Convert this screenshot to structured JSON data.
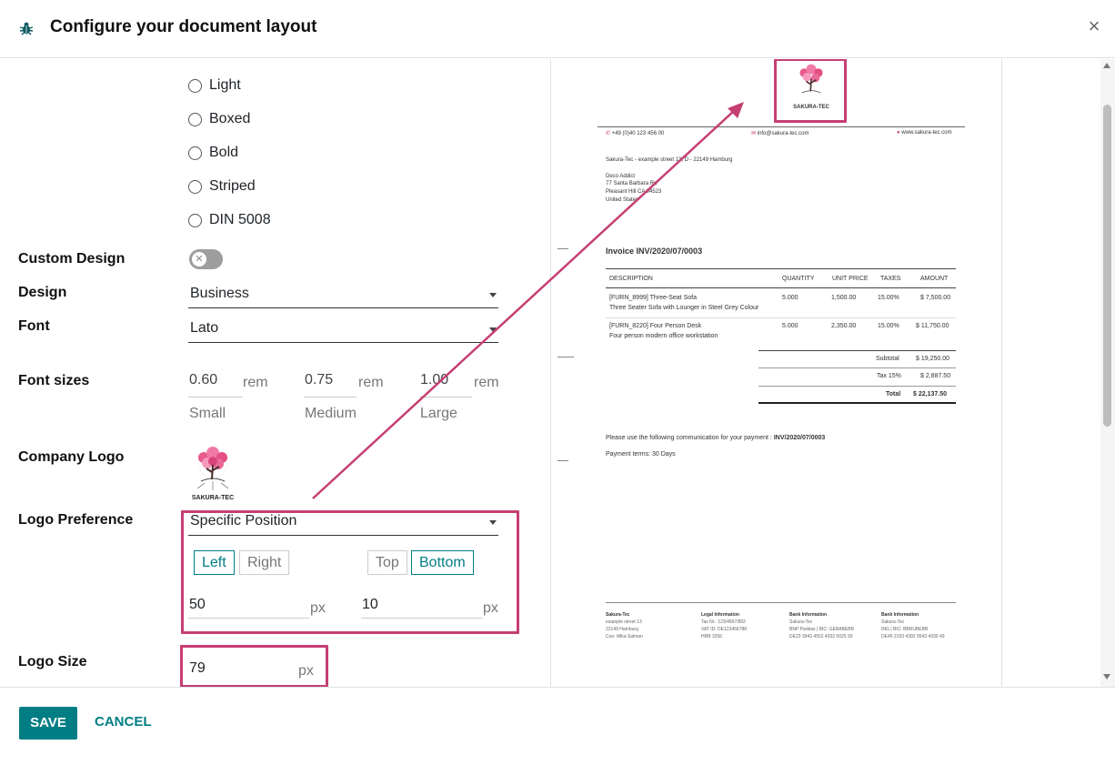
{
  "header": {
    "title": "Configure your document layout",
    "close_label": "×"
  },
  "layouts": [
    "Light",
    "Boxed",
    "Bold",
    "Striped",
    "DIN 5008"
  ],
  "fields": {
    "custom_design": "Custom Design",
    "design": "Design",
    "font": "Font",
    "font_sizes": "Font sizes",
    "company_logo": "Company Logo",
    "logo_preference": "Logo Preference",
    "logo_size": "Logo Size"
  },
  "design_value": "Business",
  "font_value": "Lato",
  "font_sizes": [
    {
      "value": "0.60",
      "unit": "rem",
      "caption": "Small"
    },
    {
      "value": "0.75",
      "unit": "rem",
      "caption": "Medium"
    },
    {
      "value": "1.00",
      "unit": "rem",
      "caption": "Large"
    }
  ],
  "logo_caption": "SAKURA-TEC",
  "logo_preference": {
    "value": "Specific Position",
    "left": "Left",
    "right": "Right",
    "top": "Top",
    "bottom": "Bottom",
    "x_value": "50",
    "y_value": "10",
    "unit": "px"
  },
  "logo_size": {
    "value": "79",
    "unit": "px"
  },
  "footer": {
    "save": "SAVE",
    "cancel": "CANCEL"
  },
  "colors": {
    "accent": "#017e84",
    "highlight": "#c53f73"
  },
  "preview": {
    "logo_caption": "SAKURA-TEC",
    "phone": "+49 (0)40 123 456 00",
    "email": "info@sakura-tec.com",
    "website": "www.sakura-tec.com",
    "sender": "Sakura-Tec - example street 13, D - 22149 Hamburg",
    "address": [
      "Deco Addict",
      "77 Santa Barbara Rd",
      "Pleasant Hill CA 94523",
      "United States"
    ],
    "invoice_title": "Invoice INV/2020/07/0003",
    "columns": [
      "DESCRIPTION",
      "QUANTITY",
      "UNIT PRICE",
      "TAXES",
      "AMOUNT"
    ],
    "rows": [
      {
        "desc1": "[FURN_8999] Three-Seat Sofa",
        "desc2": "Three Seater Sofa with Lounger in Steel Grey Colour",
        "qty": "5.000",
        "price": "1,500.00",
        "tax": "15.00%",
        "amount": "$ 7,500.00"
      },
      {
        "desc1": "[FURN_8220] Four Person Desk",
        "desc2": "Four person modern office workstation",
        "qty": "5.000",
        "price": "2,350.00",
        "tax": "15.00%",
        "amount": "$ 11,750.00"
      }
    ],
    "subtotal_label": "Subtotal",
    "subtotal": "$ 19,250.00",
    "tax_label": "Tax 15%",
    "tax": "$ 2,887.50",
    "total_label": "Total",
    "total": "$ 22,137.50",
    "communication": "Please use the following communication for your payment :",
    "communication_ref": "INV/2020/07/0003",
    "payment_terms": "Payment terms: 30 Days",
    "footer_cols": [
      {
        "title": "Sakura-Tec",
        "lines": [
          "example street 13",
          "22149 Hamburg",
          "Ceo:  Mika Salman"
        ]
      },
      {
        "title": "Legal Information",
        "lines": [
          "Tax Nr.:  123/4567/892",
          "VAT ID:  DE123456788",
          "HRB 3256"
        ]
      },
      {
        "title": "Bank Information",
        "lines": [
          "Sakura-Tec",
          "BNP Paribas  |  BIC: GEBABEBB",
          "DE23 3943 4552 4932 0025 93"
        ]
      },
      {
        "title": "Bank Information",
        "lines": [
          "Sakura-Tec",
          "ING  |  BIC: BBRUBEBB",
          "DE45 2193 4392 9543 4930 49"
        ]
      }
    ]
  }
}
